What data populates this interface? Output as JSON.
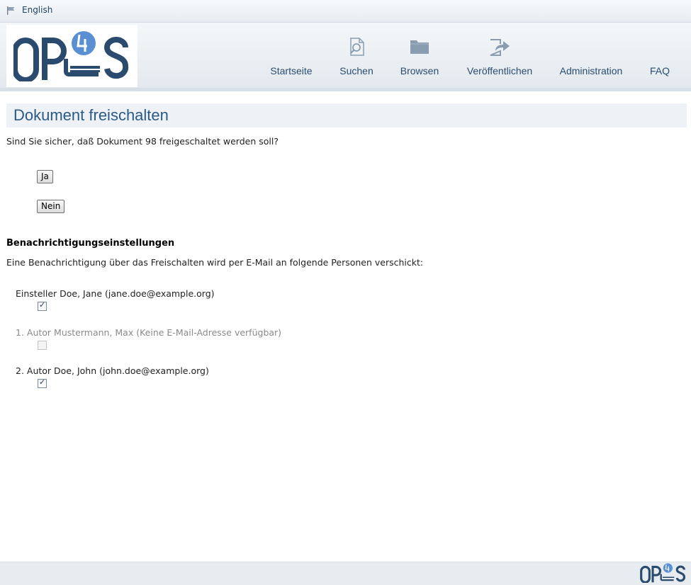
{
  "language_bar": {
    "language": "English",
    "icon": "flag-icon"
  },
  "header": {
    "logo": {
      "text": "OPUS 4",
      "icon": "opus4-logo"
    },
    "nav": [
      {
        "label": "Startseite",
        "icon": ""
      },
      {
        "label": "Suchen",
        "icon": "search-document-icon"
      },
      {
        "label": "Browsen",
        "icon": "folder-icon"
      },
      {
        "label": "Veröffentlichen",
        "icon": "publish-arrow-icon"
      },
      {
        "label": "Administration",
        "icon": ""
      },
      {
        "label": "FAQ",
        "icon": ""
      }
    ]
  },
  "page": {
    "title": "Dokument freischalten",
    "question": "Sind Sie sicher, daß Dokument 98 freigeschaltet werden soll?",
    "yes_label": "Ja",
    "no_label": "Nein"
  },
  "notification": {
    "title": "Benachrichtigungseinstellungen",
    "description": "Eine Benachrichtigung über das Freischalten wird per E-Mail an folgende Personen verschickt:",
    "recipients": [
      {
        "label": "Einsteller Doe, Jane (jane.doe@example.org)",
        "checked": true,
        "disabled": false
      },
      {
        "label": "1. Autor Mustermann, Max (Keine E-Mail-Adresse verfügbar)",
        "checked": false,
        "disabled": true
      },
      {
        "label": "2. Autor Doe, John (john.doe@example.org)",
        "checked": true,
        "disabled": false
      }
    ]
  },
  "colors": {
    "brand": "#2a4a6e",
    "accent": "#5b8fd4",
    "title": "#2a5a85"
  }
}
